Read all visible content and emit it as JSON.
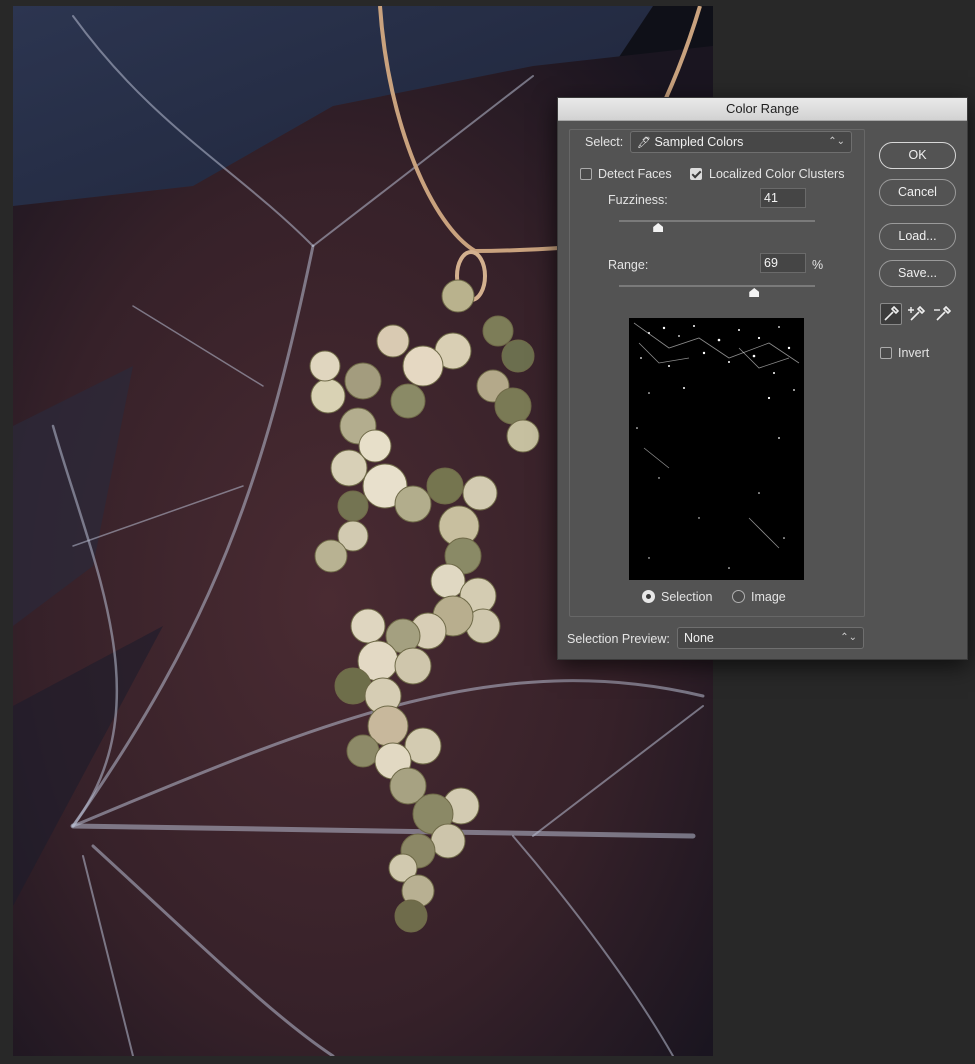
{
  "dialog": {
    "title": "Color Range",
    "select_label": "Select:",
    "select_value": "Sampled Colors",
    "detect_faces": {
      "label": "Detect Faces",
      "checked": false
    },
    "localized_clusters": {
      "label": "Localized Color Clusters",
      "checked": true
    },
    "fuzziness": {
      "label": "Fuzziness:",
      "value": "41",
      "slider_fraction": 0.2
    },
    "range": {
      "label": "Range:",
      "value": "69",
      "unit": "%",
      "slider_fraction": 0.69
    },
    "radio_selection_label": "Selection",
    "radio_image_label": "Image",
    "radio_selected": "Selection",
    "selection_preview_label": "Selection Preview:",
    "selection_preview_value": "None",
    "buttons": {
      "ok": "OK",
      "cancel": "Cancel",
      "load": "Load...",
      "save": "Save..."
    },
    "invert": {
      "label": "Invert",
      "checked": false
    },
    "eyedroppers": [
      "eyedropper-icon",
      "eyedropper-plus-icon",
      "eyedropper-minus-icon"
    ]
  },
  "colors": {
    "dialog_bg": "#535353",
    "canvas_bg": "#282828"
  }
}
